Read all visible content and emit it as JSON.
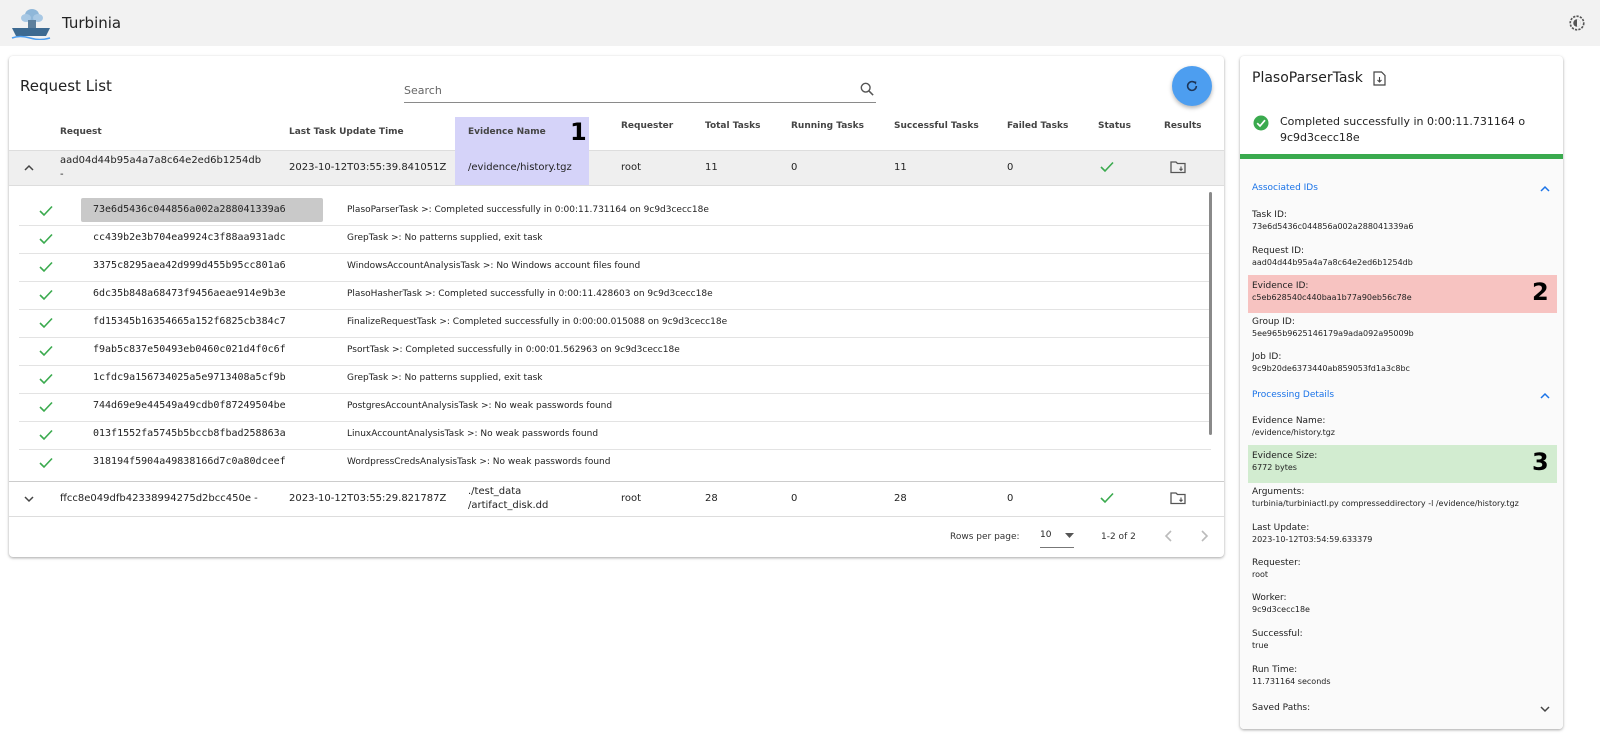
{
  "app": {
    "title": "Turbinia"
  },
  "request_list": {
    "title": "Request List",
    "search_placeholder": "Search",
    "columns": [
      "Request",
      "Last Task Update Time",
      "Evidence Name",
      "Requester",
      "Total Tasks",
      "Running Tasks",
      "Successful Tasks",
      "Failed Tasks",
      "Status",
      "Results"
    ],
    "rows": [
      {
        "request_line1": "aad04d44b95a4a7a8c64e2ed6b1254db",
        "request_line2": "-",
        "last_update": "2023-10-12T03:55:39.841051Z",
        "evidence": "/evidence/history.tgz",
        "requester": "root",
        "total": "11",
        "running": "0",
        "successful": "11",
        "failed": "0"
      },
      {
        "request_line1": "ffcc8e049dfb42338994275d2bcc450e -",
        "last_update": "2023-10-12T03:55:29.821787Z",
        "evidence_line1": "./test_data",
        "evidence_line2": "/artifact_disk.dd",
        "requester": "root",
        "total": "28",
        "running": "0",
        "successful": "28",
        "failed": "0"
      }
    ],
    "tasks": [
      {
        "id": "73e6d5436c044856a002a288041339a6",
        "message": "PlasoParserTask >: Completed successfully in 0:00:11.731164 on 9c9d3cecc18e"
      },
      {
        "id": "cc439b2e3b704ea9924c3f88aa931adc",
        "message": "GrepTask >: No patterns supplied, exit task"
      },
      {
        "id": "3375c8295aea42d999d455b95cc801a6",
        "message": "WindowsAccountAnalysisTask >: No Windows account files found"
      },
      {
        "id": "6dc35b848a68473f9456aeae914e9b3e",
        "message": "PlasoHasherTask >: Completed successfully in 0:00:11.428603 on 9c9d3cecc18e"
      },
      {
        "id": "fd15345b16354665a152f6825cb384c7",
        "message": "FinalizeRequestTask >: Completed successfully in 0:00:00.015088 on 9c9d3cecc18e"
      },
      {
        "id": "f9ab5c837e50493eb0460c021d4f0c6f",
        "message": "PsortTask >: Completed successfully in 0:00:01.562963 on 9c9d3cecc18e"
      },
      {
        "id": "1cfdc9a156734025a5e9713408a5cf9b",
        "message": "GrepTask >: No patterns supplied, exit task"
      },
      {
        "id": "744d69e9e44549a49cdb0f87249504be",
        "message": "PostgresAccountAnalysisTask >: No weak passwords found"
      },
      {
        "id": "013f1552fa5745b5bccb8fbad258863a",
        "message": "LinuxAccountAnalysisTask >: No weak passwords found"
      },
      {
        "id": "318194f5904a49838166d7c0a80dceef",
        "message": "WordpressCredsAnalysisTask >: No weak passwords found"
      }
    ],
    "pagination": {
      "rows_per_page_label": "Rows per page:",
      "rows_per_page": "10",
      "range": "1-2 of 2"
    }
  },
  "annotations": [
    "1",
    "2",
    "3"
  ],
  "detail": {
    "title": "PlasoParserTask",
    "status": "Completed successfully in 0:00:11.731164 o 9c9d3cecc18e",
    "associated_ids_title": "Associated IDs",
    "processing_title": "Processing Details",
    "fields": {
      "task_id_label": "Task ID:",
      "task_id": "73e6d5436c044856a002a288041339a6",
      "request_id_label": "Request ID:",
      "request_id": "aad04d44b95a4a7a8c64e2ed6b1254db",
      "evidence_id_label": "Evidence ID:",
      "evidence_id": "c5eb628540c440baa1b77a90eb56c78e",
      "group_id_label": "Group ID:",
      "group_id": "5ee965b9625146179a9ada092a95009b",
      "job_id_label": "Job ID:",
      "job_id": "9c9b20de6373440ab859053fd1a3c8bc",
      "evidence_name_label": "Evidence Name:",
      "evidence_name": "/evidence/history.tgz",
      "evidence_size_label": "Evidence Size:",
      "evidence_size": "6772 bytes",
      "arguments_label": "Arguments:",
      "arguments": "turbinia/turbiniactl.py compresseddirectory -l /evidence/history.tgz",
      "last_update_label": "Last Update:",
      "last_update": "2023-10-12T03:54:59.633379",
      "requester_label": "Requester:",
      "requester": "root",
      "worker_label": "Worker:",
      "worker": "9c9d3cecc18e",
      "successful_label": "Successful:",
      "successful": "true",
      "run_time_label": "Run Time:",
      "run_time": "11.731164 seconds",
      "saved_paths_label": "Saved Paths:"
    }
  },
  "colors": {
    "accent": "#4d9ef0",
    "success": "#3aaa4e",
    "link": "#1a73e8",
    "evidence_highlight": "#d5d3f9",
    "red_highlight": "#f7c3c1",
    "green_highlight": "#d2ecd0"
  }
}
